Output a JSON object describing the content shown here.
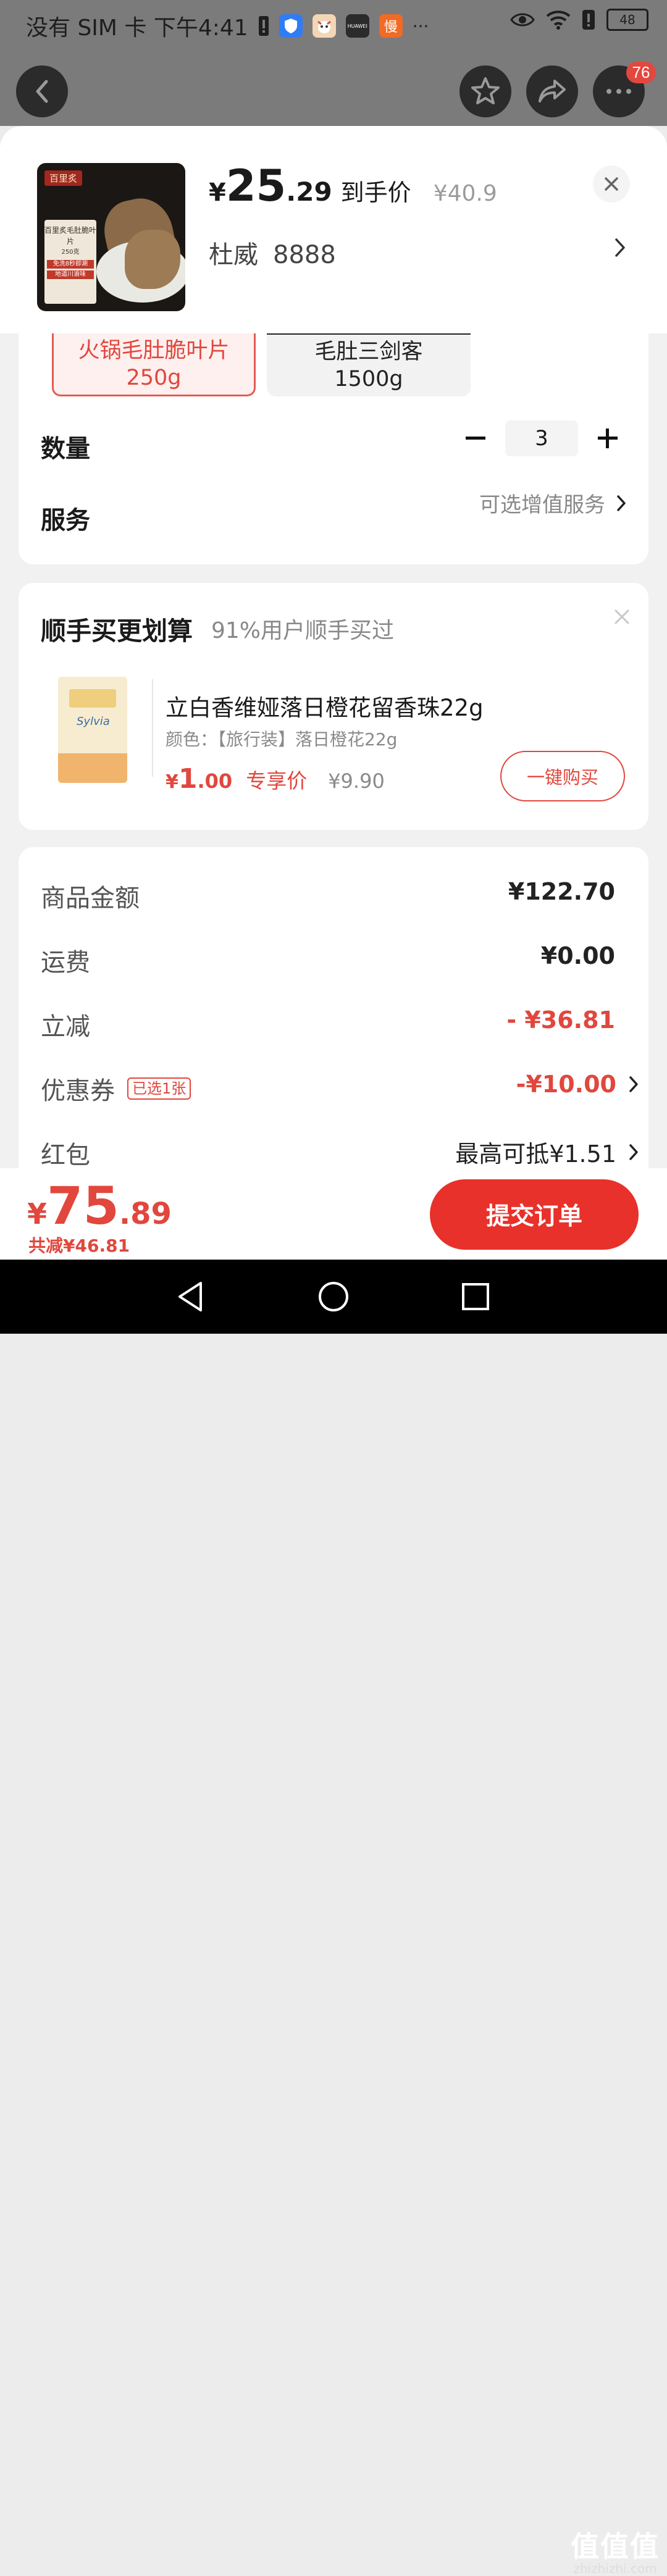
{
  "status_bar": {
    "carrier_time": "没有 SIM 卡 下午4:41",
    "app_icon_label": "慢",
    "huawei_label": "HUAWEI",
    "more_dots": "···",
    "battery": "48"
  },
  "top_nav": {
    "cart_badge": "76"
  },
  "product": {
    "thumb_brand": "百里炙",
    "thumb_title": "百里炙毛肚脆叶片",
    "thumb_weight": "250克",
    "thumb_promo1": "免洗8秒即涮",
    "thumb_promo2": "地道川渝味",
    "price_yen": "¥",
    "price_int": "25",
    "price_dec": ".29",
    "price_tag": "到手价",
    "price_orig": "¥40.9",
    "name_addr": "杜威",
    "phone": "8888"
  },
  "specs": {
    "options": [
      {
        "line1": "火锅毛肚脆叶片",
        "line2": "250g",
        "selected": true
      },
      {
        "line1": "毛肚三剑客",
        "line2": "1500g",
        "selected": false
      }
    ],
    "qty_label": "数量",
    "qty_value": "3",
    "service_label": "服务",
    "service_value": "可选增值服务"
  },
  "addon": {
    "title": "顺手买更划算",
    "subtitle": "91%用户顺手买过",
    "img_logo": "Sylvia",
    "name": "立白香维娅落日橙花留香珠22g",
    "color": "颜色：【旅行装】落日橙花22g",
    "price_yen": "¥",
    "price_int": "1",
    "price_dec": ".00",
    "price_tag": "专享价",
    "price_orig": "¥9.90",
    "buy_label": "一键购买"
  },
  "summary": {
    "rows": [
      {
        "key": "商品金额",
        "value": "¥122.70"
      },
      {
        "key": "运费",
        "value": "¥0.00"
      },
      {
        "key": "立减",
        "value": "- ¥36.81"
      },
      {
        "key": "优惠券",
        "tag": "已选1张",
        "value": "-¥10.00"
      },
      {
        "key": "红包",
        "value": "最高可抵¥1.51"
      }
    ]
  },
  "paybar": {
    "total_yen": "¥",
    "total_int": "75",
    "total_dec": ".89",
    "saving": "共减¥46.81",
    "submit_label": "提交订单"
  },
  "watermark": {
    "title": "值值值",
    "url": "zhizhizhi.com"
  },
  "colors": {
    "accent": "#e1473d",
    "submit": "#e8312a",
    "overlay": "#7b7b7b"
  }
}
